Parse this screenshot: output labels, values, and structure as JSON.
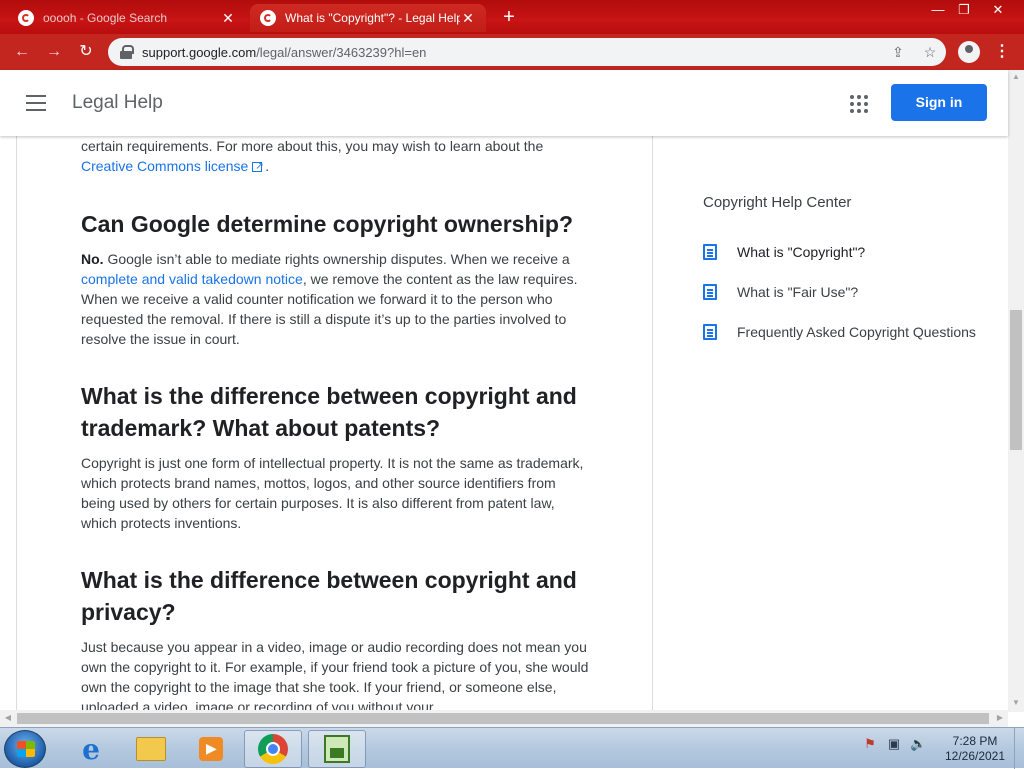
{
  "browser": {
    "tabs": [
      {
        "title": "ooooh - Google Search",
        "active": false
      },
      {
        "title": "What is \"Copyright\"? - Legal Help",
        "active": true
      }
    ],
    "new_tab_label": "+",
    "window_controls": {
      "minimize": "—",
      "maximize": "❐",
      "close": "✕"
    },
    "url_host": "support.google.com",
    "url_path": "/legal/answer/3463239?hl=en",
    "menu_glyph": "⋮"
  },
  "site_header": {
    "title": "Legal Help",
    "signin_label": "Sign in"
  },
  "article": {
    "intro_text": "certain requirements. For more about this, you may wish to learn about the",
    "intro_link": "Creative Commons license",
    "intro_end": ".",
    "sections": [
      {
        "heading": "Can Google determine copyright ownership?",
        "bold_lead": "No.",
        "text_1": " Google isn’t able to mediate rights ownership disputes. When we receive a ",
        "link": "complete and valid takedown notice",
        "text_2": ", we remove the content as the law requires. When we receive a valid counter notification we forward it to the person who requested the removal. If there is still a dispute it’s up to the parties involved to resolve the issue in court."
      },
      {
        "heading": "What is the difference between copyright and trademark? What about patents?",
        "body": "Copyright is just one form of intellectual property. It is not the same as trademark, which protects brand names, mottos, logos, and other source identifiers from being used by others for certain purposes. It is also different from patent law, which protects inventions."
      },
      {
        "heading": "What is the difference between copyright and privacy?",
        "body": "Just because you appear in a video, image or audio recording does not mean you own the copyright to it. For example, if your friend took a picture of you, she would own the copyright to the image that she took. If your friend, or someone else, uploaded a video, image or recording of you without your"
      }
    ]
  },
  "sidebar": {
    "title": "Copyright Help Center",
    "items": [
      {
        "label": "What is \"Copyright\"?",
        "active": true
      },
      {
        "label": "What is \"Fair Use\"?",
        "active": false
      },
      {
        "label": "Frequently Asked Copyright Questions",
        "active": false
      }
    ]
  },
  "taskbar": {
    "clock_time": "7:28 PM",
    "clock_date": "12/26/2021"
  },
  "colors": {
    "accent": "#1a73e8",
    "browser_frame": "#c3251f"
  }
}
